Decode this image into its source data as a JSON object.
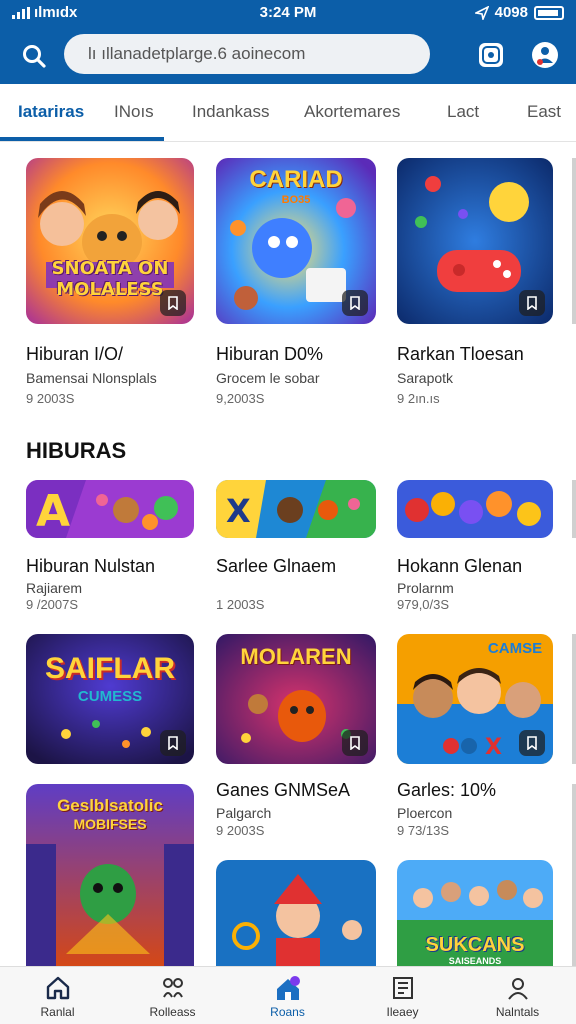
{
  "status_bar": {
    "carrier": "ılmıdx",
    "time": "3:24 PM",
    "right_text": "4098"
  },
  "header": {
    "search_text": "lı ıllanadetplarge.6 aoinecom"
  },
  "tabs": [
    {
      "label": "Iatariras",
      "active": true
    },
    {
      "label": "INoıs"
    },
    {
      "label": "Indankass"
    },
    {
      "label": "Akortemares"
    },
    {
      "label": "Lact"
    },
    {
      "label": "East"
    }
  ],
  "row1": [
    {
      "title": "Hiburan I/O/",
      "subtitle": "Bamensai Nlonsplals",
      "meta": "9 2003S",
      "art": "SNOATA ON MOLALESS",
      "art_sub": ""
    },
    {
      "title": "Hiburan D0%",
      "subtitle": "Grocem le sobar",
      "meta": "9,2003S",
      "art": "CARIAD",
      "art_sub": "BO35"
    },
    {
      "title": "Rarkan Tloesan",
      "subtitle": "Sarapotk",
      "meta": "9 2ın.ıs",
      "art": "",
      "art_sub": ""
    }
  ],
  "section_title": "HIBURAS",
  "row2": [
    {
      "title": "Hiburan Nulstan",
      "subtitle": "Rajiarem",
      "meta": "9 /2007S"
    },
    {
      "title": "Sarlee Glnaem",
      "subtitle": "",
      "meta": "1 2003S"
    },
    {
      "title": "Hokann Glenan",
      "subtitle": "Prolarnm",
      "meta": "979,0/3S"
    }
  ],
  "row3": [
    {
      "title": "",
      "subtitle": "",
      "meta": "",
      "art": "SAIFLAR",
      "art_sub": "CUMESS"
    },
    {
      "title": "Ganes GNMSeA",
      "subtitle": "Palgarch",
      "meta": "9 2003S",
      "art": "MOLAREN",
      "art_sub": ""
    },
    {
      "title": "Garles: 10%",
      "subtitle": "Ploercon",
      "meta": "9 73/13S",
      "art": "CAMSE",
      "art_sub": ""
    }
  ],
  "row4": [
    {
      "art": "Geslblsatolic",
      "art_sub": "MOBIFSES"
    },
    {
      "art": "",
      "art_sub": ""
    },
    {
      "art": "SUKCANS",
      "art_sub": "SAISEANDS"
    }
  ],
  "bottom_nav": [
    {
      "label": "Ranlal",
      "icon": "home-icon"
    },
    {
      "label": "Rolleass",
      "icon": "rollers-icon"
    },
    {
      "label": "Roans",
      "icon": "house-badge-icon",
      "active": true
    },
    {
      "label": "Ileaey",
      "icon": "book-icon"
    },
    {
      "label": "Nalntals",
      "icon": "person-icon"
    }
  ],
  "colors": {
    "accent": "#0c5ea8",
    "badge": "#7c3aed"
  }
}
